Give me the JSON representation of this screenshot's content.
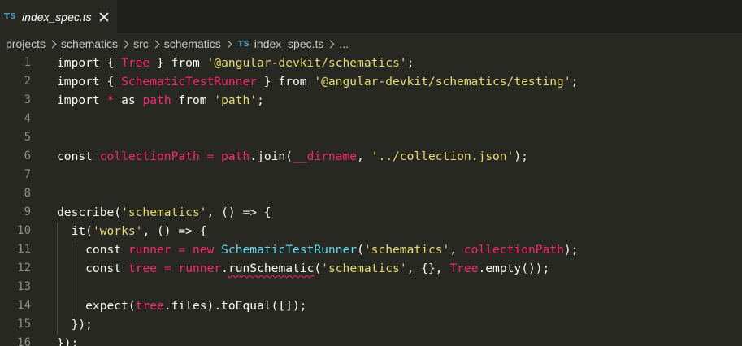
{
  "tab": {
    "badge": "TS",
    "filename": "index_spec.ts"
  },
  "breadcrumb": {
    "items": [
      "projects",
      "schematics",
      "src",
      "schematics"
    ],
    "file_badge": "TS",
    "file": "index_spec.ts",
    "trailing": "..."
  },
  "editor": {
    "line_numbers": [
      "1",
      "2",
      "3",
      "4",
      "5",
      "6",
      "7",
      "8",
      "9",
      "10",
      "11",
      "12",
      "13",
      "14",
      "15",
      "16"
    ],
    "lines": [
      [
        {
          "t": "import { ",
          "c": "plain"
        },
        {
          "t": "Tree",
          "c": "pink"
        },
        {
          "t": " } ",
          "c": "plain"
        },
        {
          "t": "from",
          "c": "plain"
        },
        {
          "t": " ",
          "c": "plain"
        },
        {
          "t": "'@angular-devkit/schematics'",
          "c": "str"
        },
        {
          "t": ";",
          "c": "plain"
        }
      ],
      [
        {
          "t": "import { ",
          "c": "plain"
        },
        {
          "t": "SchematicTestRunner",
          "c": "pink"
        },
        {
          "t": " } ",
          "c": "plain"
        },
        {
          "t": "from",
          "c": "plain"
        },
        {
          "t": " ",
          "c": "plain"
        },
        {
          "t": "'@angular-devkit/schematics/testing'",
          "c": "str"
        },
        {
          "t": ";",
          "c": "plain"
        }
      ],
      [
        {
          "t": "import ",
          "c": "plain"
        },
        {
          "t": "*",
          "c": "pink"
        },
        {
          "t": " as ",
          "c": "plain"
        },
        {
          "t": "path",
          "c": "pink"
        },
        {
          "t": " from ",
          "c": "plain"
        },
        {
          "t": "'path'",
          "c": "str"
        },
        {
          "t": ";",
          "c": "plain"
        }
      ],
      [],
      [],
      [
        {
          "t": "const ",
          "c": "plain"
        },
        {
          "t": "collectionPath",
          "c": "pink"
        },
        {
          "t": " ",
          "c": "plain"
        },
        {
          "t": "=",
          "c": "pink"
        },
        {
          "t": " ",
          "c": "plain"
        },
        {
          "t": "path",
          "c": "pink"
        },
        {
          "t": ".join(",
          "c": "plain"
        },
        {
          "t": "__dirname",
          "c": "pink"
        },
        {
          "t": ", ",
          "c": "plain"
        },
        {
          "t": "'../collection.json'",
          "c": "str"
        },
        {
          "t": ");",
          "c": "plain"
        }
      ],
      [],
      [],
      [
        {
          "t": "describe(",
          "c": "plain"
        },
        {
          "t": "'schematics'",
          "c": "str"
        },
        {
          "t": ", () => {",
          "c": "plain"
        }
      ],
      [
        {
          "t": "  it(",
          "c": "plain"
        },
        {
          "t": "'works'",
          "c": "str"
        },
        {
          "t": ", () => {",
          "c": "plain"
        }
      ],
      [
        {
          "t": "    const ",
          "c": "plain"
        },
        {
          "t": "runner",
          "c": "pink"
        },
        {
          "t": " ",
          "c": "plain"
        },
        {
          "t": "=",
          "c": "pink"
        },
        {
          "t": " ",
          "c": "plain"
        },
        {
          "t": "new",
          "c": "pink"
        },
        {
          "t": " ",
          "c": "plain"
        },
        {
          "t": "SchematicTestRunner",
          "c": "cls"
        },
        {
          "t": "(",
          "c": "plain"
        },
        {
          "t": "'schematics'",
          "c": "str"
        },
        {
          "t": ", ",
          "c": "plain"
        },
        {
          "t": "collectionPath",
          "c": "pink"
        },
        {
          "t": ");",
          "c": "plain"
        }
      ],
      [
        {
          "t": "    const ",
          "c": "plain"
        },
        {
          "t": "tree",
          "c": "pink"
        },
        {
          "t": " ",
          "c": "plain"
        },
        {
          "t": "=",
          "c": "pink"
        },
        {
          "t": " ",
          "c": "plain"
        },
        {
          "t": "runner",
          "c": "pink"
        },
        {
          "t": ".",
          "c": "plain"
        },
        {
          "t": "runSchematic",
          "c": "squig"
        },
        {
          "t": "(",
          "c": "plain"
        },
        {
          "t": "'schematics'",
          "c": "str"
        },
        {
          "t": ", {}, ",
          "c": "plain"
        },
        {
          "t": "Tree",
          "c": "pink"
        },
        {
          "t": ".empty());",
          "c": "plain"
        }
      ],
      [],
      [
        {
          "t": "    expect(",
          "c": "plain"
        },
        {
          "t": "tree",
          "c": "pink"
        },
        {
          "t": ".files).toEqual([]);",
          "c": "plain"
        }
      ],
      [
        {
          "t": "  });",
          "c": "plain"
        }
      ],
      [
        {
          "t": "});",
          "c": "plain"
        }
      ]
    ]
  },
  "colors": {
    "background": "#272822",
    "tabbar": "#1e1f1c",
    "keyword_pink": "#f92672",
    "string_yellow": "#e6db74",
    "class_blue": "#66d9ef",
    "ts_badge": "#519aba"
  },
  "icons": {
    "close": "close-icon",
    "chevron": "chevron-right-icon"
  }
}
